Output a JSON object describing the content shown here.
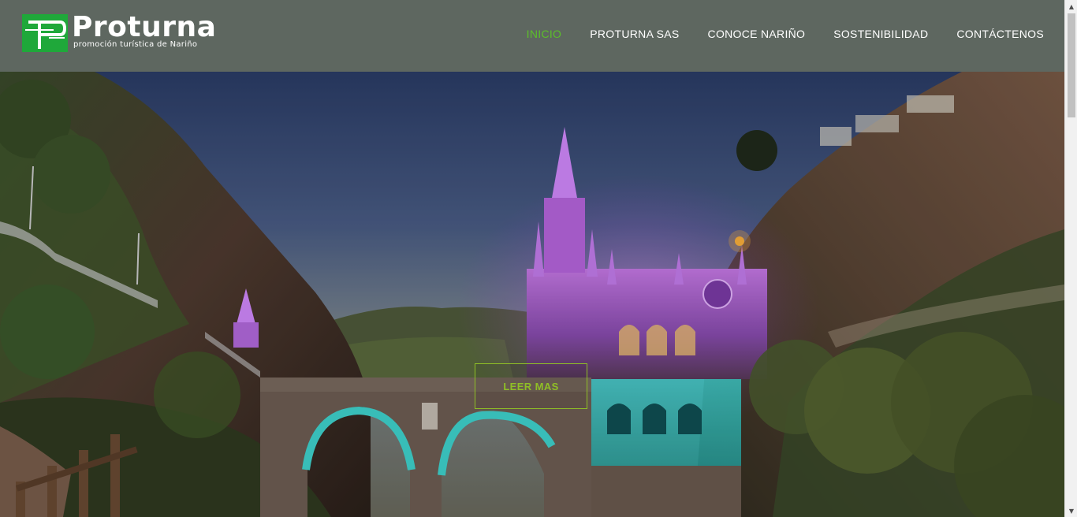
{
  "brand": {
    "name": "Proturna",
    "tagline": "promoción turística de Nariño",
    "accent": "#5cbf2a",
    "mark_color": "#1fa83a"
  },
  "nav": {
    "items": [
      {
        "label": "INICIO",
        "active": true
      },
      {
        "label": "PROTURNA SAS",
        "active": false
      },
      {
        "label": "CONOCE NARIÑO",
        "active": false
      },
      {
        "label": "SOSTENIBILIDAD",
        "active": false
      },
      {
        "label": "CONTÁCTENOS",
        "active": false
      }
    ]
  },
  "hero": {
    "button_label": "LEER MAS",
    "button_color": "#8fbf26"
  },
  "scrollbar": {
    "up_icon": "arrow-up-icon",
    "down_icon": "arrow-down-icon"
  }
}
